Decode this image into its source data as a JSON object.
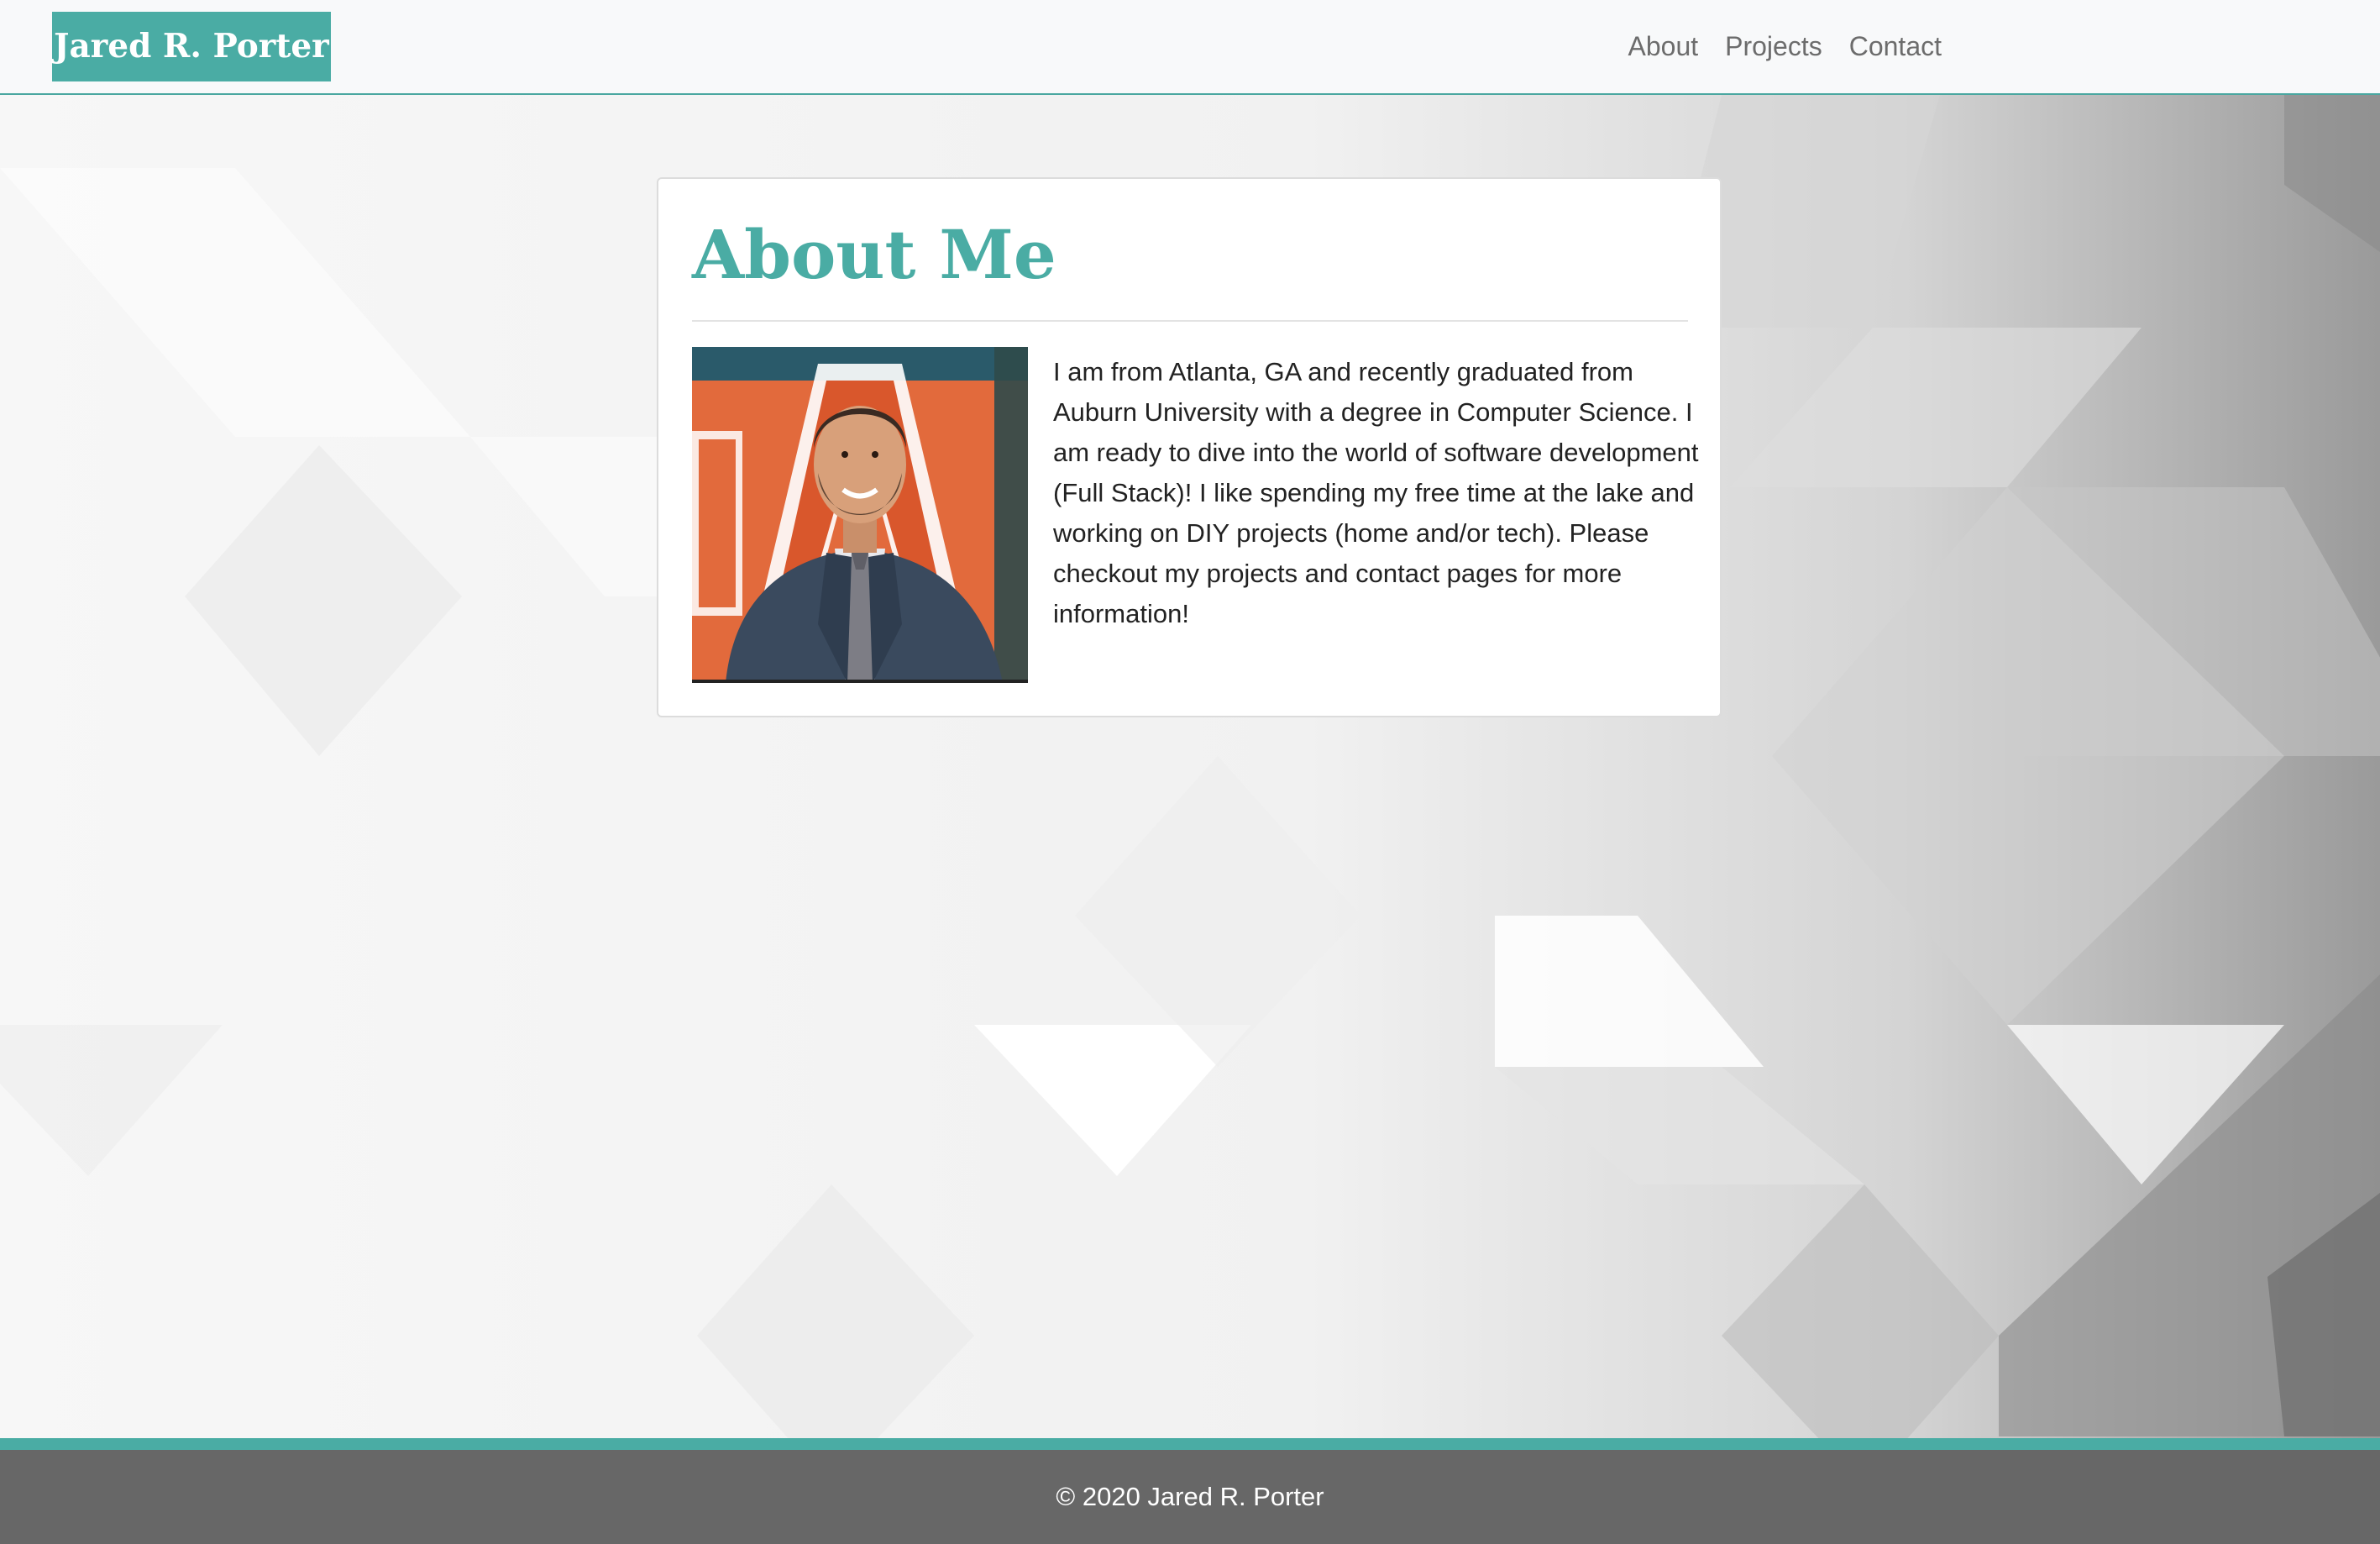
{
  "navbar": {
    "brand": "Jared R. Porter",
    "links": [
      {
        "label": "About"
      },
      {
        "label": "Projects"
      },
      {
        "label": "Contact"
      }
    ]
  },
  "about": {
    "title": "About Me",
    "paragraph": "I am from Atlanta, GA and recently graduated from Auburn University with a degree in Computer Science. I am ready to dive into the world of software development (Full Stack)! I like spending my free time at the lake and working on DIY projects (home and/or tech). Please checkout my projects and contact pages for more information!"
  },
  "footer": {
    "text": "© 2020 Jared R. Porter"
  },
  "colors": {
    "accent": "#4aaca4",
    "navbar_bg": "#f8f9fa",
    "footer_bg": "#676767",
    "nav_link": "#6c6c6c",
    "portrait_bg": "#e26a3c",
    "suit": "#3a4a5e"
  }
}
